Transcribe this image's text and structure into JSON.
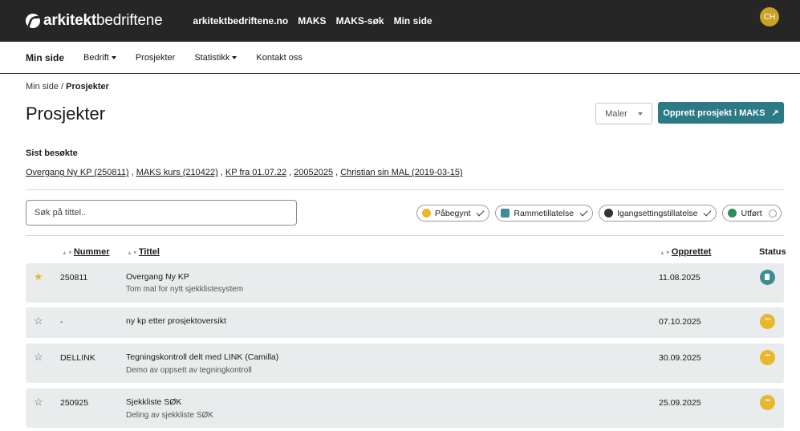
{
  "topbar": {
    "logo_bold": "arkitekt",
    "logo_light": "bedriftene",
    "links": [
      "arkitektbedriftene.no",
      "MAKS",
      "MAKS-søk",
      "Min side"
    ],
    "avatar_initials": "CH"
  },
  "subnav": {
    "items": [
      "Min side",
      "Bedrift",
      "Prosjekter",
      "Statistikk",
      "Kontakt oss"
    ]
  },
  "breadcrumb": {
    "root": "Min side",
    "separator": " / ",
    "current": "Prosjekter"
  },
  "page_title": "Prosjekter",
  "actions": {
    "maler_label": "Maler",
    "create_label": "Opprett prosjekt i MAKS",
    "create_icon": "↗"
  },
  "recent": {
    "heading": "Sist besøkte",
    "items": [
      "Overgang Ny KP (250811)",
      "MAKS kurs (210422)",
      "KP fra 01.07.22",
      "20052025",
      "Christian sin MAL (2019-03-15)"
    ]
  },
  "search": {
    "placeholder": "Søk på tittel.."
  },
  "filters": [
    {
      "label": "Påbegynt",
      "color": "#e8b72d"
    },
    {
      "label": "Rammetillatelse",
      "color": "#3d8d97"
    },
    {
      "label": "Igangsettingstillatelse",
      "color": "#333333"
    },
    {
      "label": "Utført",
      "color": "#2e8b57"
    }
  ],
  "table": {
    "headers": {
      "number": "Nummer",
      "title": "Tittel",
      "created": "Opprettet",
      "status": "Status"
    },
    "rows": [
      {
        "starred": true,
        "number": "250811",
        "title": "Overgang Ny KP",
        "desc": "Tom mal for nytt sjekklistesystem",
        "created": "11.08.2025",
        "status": "rammetillatelse"
      },
      {
        "starred": false,
        "number": "-",
        "title": "ny kp etter prosjektoversikt",
        "desc": "",
        "created": "07.10.2025",
        "status": "påbegynt"
      },
      {
        "starred": false,
        "number": "DELLINK",
        "title": "Tegningskontroll delt med LINK (Camilla)",
        "desc": "Demo av oppsett av tegningkontroll",
        "created": "30.09.2025",
        "status": "påbegynt"
      },
      {
        "starred": false,
        "number": "250925",
        "title": "Sjekkliste SØK",
        "desc": "Deling av sjekkliste SØK",
        "created": "25.09.2025",
        "status": "påbegynt"
      }
    ]
  }
}
